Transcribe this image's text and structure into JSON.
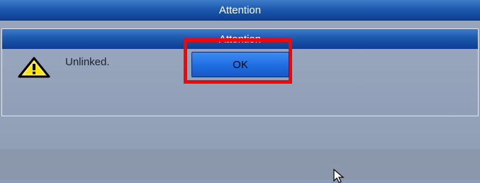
{
  "window": {
    "title": "Attention"
  },
  "dialog": {
    "title": "Attention",
    "icon": "warning-icon",
    "message": "Unlinked.",
    "ok_label": "OK"
  },
  "colors": {
    "titlebar": "#1d5bb0",
    "button": "#2070e3",
    "highlight": "#ff0000",
    "warning": "#ffe400"
  }
}
